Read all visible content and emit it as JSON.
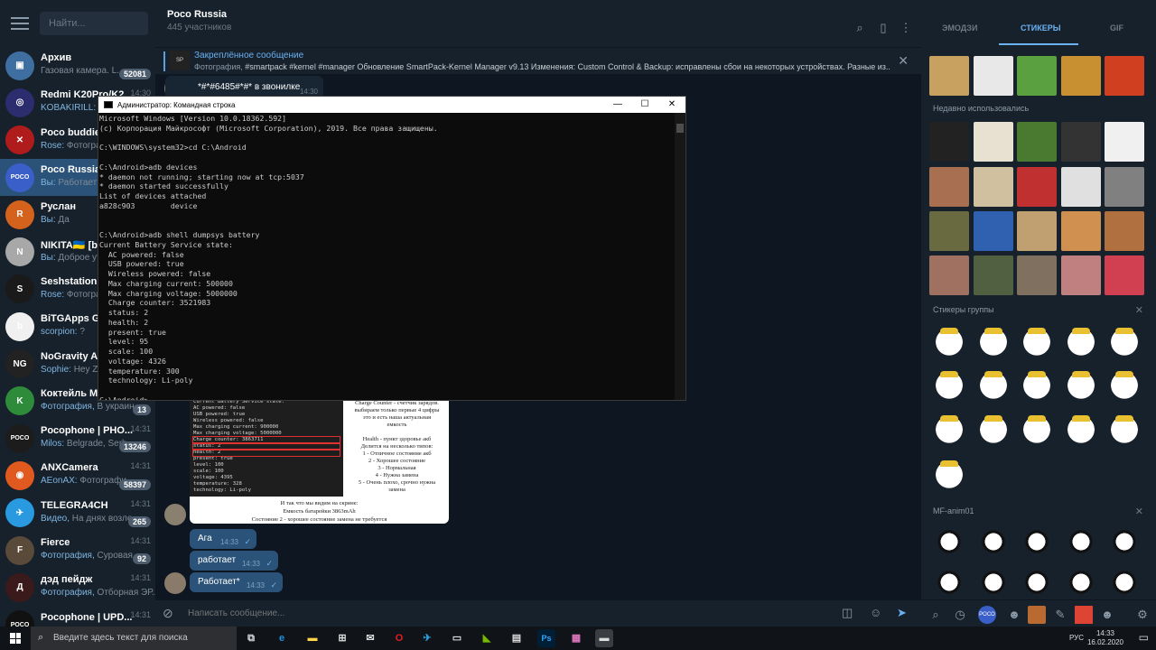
{
  "sidebar": {
    "search_placeholder": "Найти...",
    "chats": [
      {
        "name": "Архив",
        "preview": "Газовая камера. L...",
        "sender": "",
        "time": "",
        "badge": "52081",
        "avatar_color": "#3f6ea0",
        "avatar_text": "▣",
        "active": false
      },
      {
        "name": "Redmi K20Pro/K2...",
        "preview": "У...",
        "sender": "KOBAKIRILL:",
        "time": "14:30",
        "badge": "",
        "avatar_color": "#2b2d6e",
        "avatar_text": "◎",
        "active": false
      },
      {
        "name": "Poco buddies",
        "preview": "Фотограф...",
        "sender": "Rose:",
        "time": "",
        "badge": "",
        "avatar_color": "#b01c1c",
        "avatar_text": "✕",
        "active": false
      },
      {
        "name": "Poco Russia",
        "preview": "Работает*",
        "sender": "Вы:",
        "time": "",
        "badge": "",
        "avatar_color": "#3a5fc8",
        "avatar_text": "POCO",
        "active": true
      },
      {
        "name": "Руслан",
        "preview": "Да",
        "sender": "Вы:",
        "time": "",
        "badge": "",
        "avatar_color": "#d4621c",
        "avatar_text": "R",
        "active": false
      },
      {
        "name": "NIKITA🇺🇦 [beryl...",
        "preview": "Доброе утр...",
        "sender": "Вы:",
        "time": "",
        "badge": "",
        "avatar_color": "#a8a8a8",
        "avatar_text": "N",
        "active": false
      },
      {
        "name": "Seshstation",
        "preview": "Фотограф...",
        "sender": "Rose:",
        "time": "",
        "badge": "",
        "avatar_color": "#1a1a1a",
        "avatar_text": "S",
        "active": false
      },
      {
        "name": "BiTGApps Gr...",
        "preview": "?",
        "sender": "scorpion:",
        "time": "",
        "badge": "",
        "avatar_color": "#f0f0f0",
        "avatar_text": "b",
        "active": false
      },
      {
        "name": "NoGravity A...",
        "preview": "Hey Zell...",
        "sender": "Sophie:",
        "time": "",
        "badge": "",
        "avatar_color": "#222222",
        "avatar_text": "NG",
        "active": false
      },
      {
        "name": "Коктейль М...",
        "preview": "В украин...",
        "sender": "Фотография,",
        "time": "",
        "badge": "13",
        "avatar_color": "#2e8b3a",
        "avatar_text": "K",
        "active": false
      },
      {
        "name": "Pocophone | PHO...",
        "preview": "Belgrade, Serb...",
        "sender": "Milos:",
        "time": "14:31",
        "badge": "13246",
        "avatar_color": "#1c1c1c",
        "avatar_text": "POCO",
        "active": false
      },
      {
        "name": "ANXCamera",
        "preview": "Фотографи...",
        "sender": "AEonAX:",
        "time": "14:31",
        "badge": "58397",
        "avatar_color": "#e05a20",
        "avatar_text": "◉",
        "active": false
      },
      {
        "name": "TELEGRA4CH",
        "preview": "На днях возле ...",
        "sender": "Видео,",
        "time": "14:31",
        "badge": "265",
        "avatar_color": "#2a9ae0",
        "avatar_text": "✈",
        "active": false
      },
      {
        "name": "Fierce",
        "preview": "Суровая ...",
        "sender": "Фотография,",
        "time": "14:31",
        "badge": "92",
        "avatar_color": "#5a4a3a",
        "avatar_text": "F",
        "active": false
      },
      {
        "name": "дэд пейдж",
        "preview": "Отборная ЭР...",
        "sender": "Фотография,",
        "time": "14:31",
        "badge": "",
        "avatar_color": "#3a1a1a",
        "avatar_text": "Д",
        "active": false
      },
      {
        "name": "Pocophone | UPD...",
        "preview": "",
        "sender": "",
        "time": "14:31",
        "badge": "",
        "avatar_color": "#111111",
        "avatar_text": "POCO",
        "active": false
      }
    ]
  },
  "header": {
    "title": "Poco Russia",
    "subtitle": "445 участников"
  },
  "pinned": {
    "title": "Закреплённое сообщение",
    "thumb": "SP",
    "prefix": "Фотография,",
    "text": " #smartpack #kernel #manager Обновление SmartPack-Kernel Manager v9.13  Изменения: Custom Control & Backup: исправлены сбои на некоторых устройствах. Разные из..."
  },
  "messages": {
    "top_text": "*#*#6485#*#* в звонилке",
    "top_time": "14:30",
    "image": {
      "terminal_lines": [
        "Current Battery Service state:",
        "AC powered: false",
        "USB powered: true",
        "Wireless powered: false",
        "Max charging current: 900000",
        "Max charging voltage: 5000000",
        "Charge counter: 3863711",
        "status: 2",
        "health: 2",
        "present: true",
        "level: 100",
        "scale: 100",
        "voltage: 4395",
        "temperature: 328",
        "technology: Li-poly"
      ],
      "right_lines": [
        "Charge Counter - счетчик зарядов.",
        "выбираем только первые 4 цифры",
        "это и есть наша актуальная",
        "емкость",
        "",
        "Health - пункт здоровье акб",
        "Делится на несколько типов:",
        "1 - Отличное состояние акб",
        "2 - Хорошее состояние",
        "3 - Нормальная",
        "4 - Нужна замена",
        "5 - Очень плохо, срочно нужна",
        "замена"
      ],
      "caption_lines": [
        "И так что мы видим на скрине:",
        "Емкость батарейки 3863mAh",
        "Состояние 2 - хорошее состояние замена не требуется"
      ]
    },
    "outgoing": [
      {
        "text": "Ага",
        "time": "14:33"
      },
      {
        "text": "работает",
        "time": "14:33"
      },
      {
        "text": "Работает*",
        "time": "14:33"
      }
    ]
  },
  "composer": {
    "placeholder": "Написать сообщение..."
  },
  "cmd": {
    "title": "Администратор: Командная строка",
    "lines": [
      "Microsoft Windows [Version 10.0.18362.592]",
      "(c) Корпорация Майкрософт (Microsoft Corporation), 2019. Все права защищены.",
      "",
      "C:\\WINDOWS\\system32>cd C:\\Android",
      "",
      "C:\\Android>adb devices",
      "* daemon not running; starting now at tcp:5037",
      "* daemon started successfully",
      "List of devices attached",
      "a828c903        device",
      "",
      "",
      "C:\\Android>adb shell dumpsys battery",
      "Current Battery Service state:",
      "  AC powered: false",
      "  USB powered: true",
      "  Wireless powered: false",
      "  Max charging current: 500000",
      "  Max charging voltage: 5000000",
      "  Charge counter: 3521983",
      "  status: 2",
      "  health: 2",
      "  present: true",
      "  level: 95",
      "  scale: 100",
      "  voltage: 4326",
      "  temperature: 300",
      "  technology: Li-poly",
      "",
      "C:\\Android>"
    ]
  },
  "stickers": {
    "tabs": [
      "ЭМОДЗИ",
      "СТИКЕРЫ",
      "GIF"
    ],
    "active_tab": "СТИКЕРЫ",
    "recent_title": "Недавно использовались",
    "group_title": "Стикеры группы",
    "pack_title": "MF-anim01"
  },
  "taskbar": {
    "search_placeholder": "Введите здесь текст для поиска",
    "lang": "РУС",
    "time": "14:33",
    "date": "16.02.2020"
  }
}
